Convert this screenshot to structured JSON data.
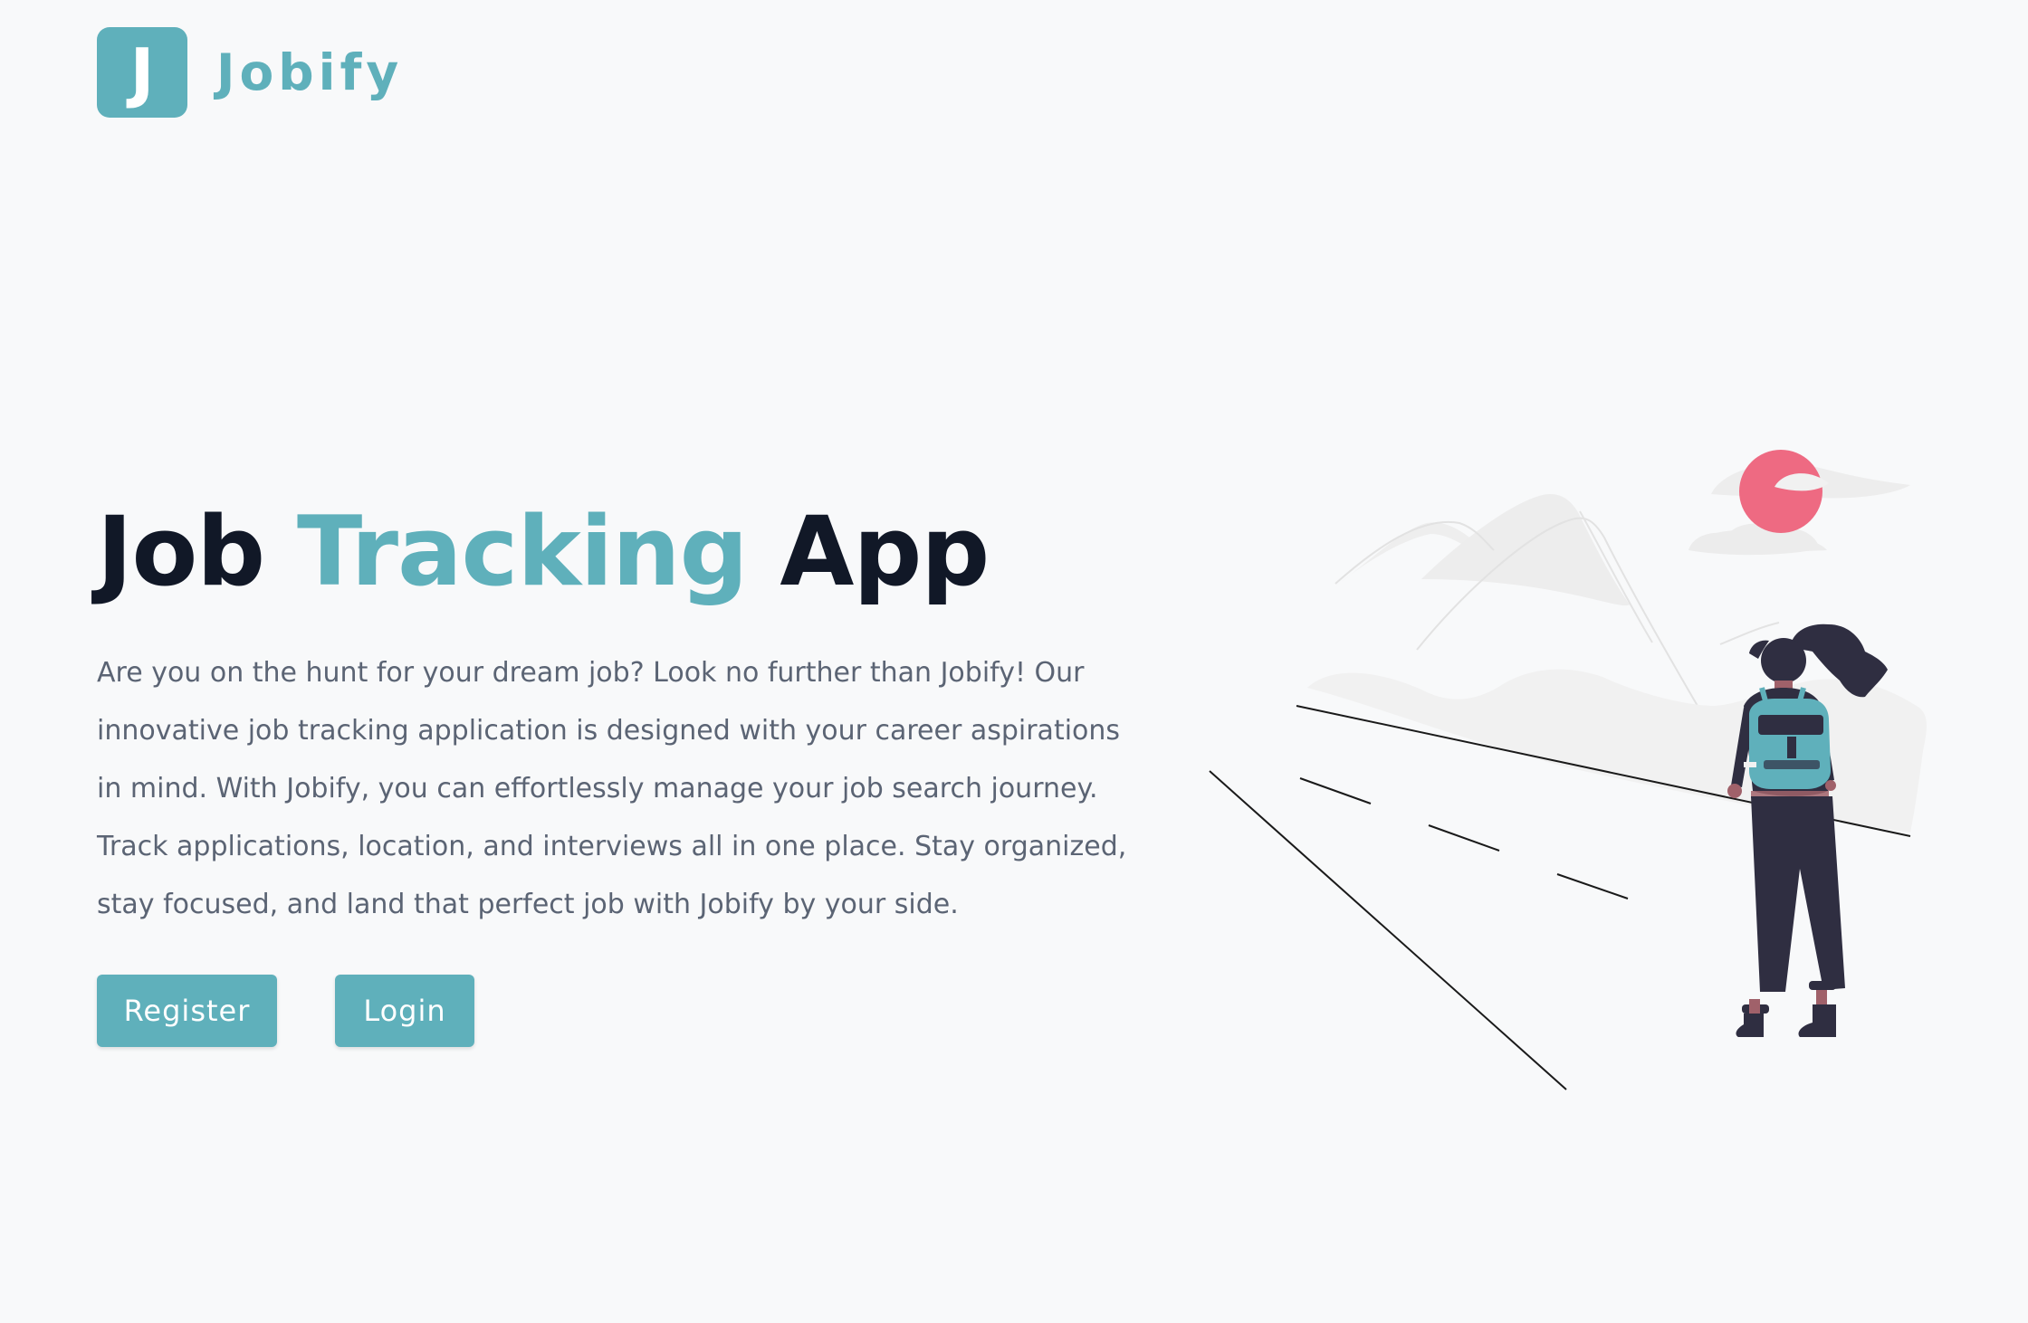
{
  "brand": {
    "logo_letter": "J",
    "name": "Jobify",
    "accent_color": "#5fb0bb"
  },
  "hero": {
    "title_part1": "Job",
    "title_accent": "Tracking",
    "title_part2": "App",
    "description": "Are you on the hunt for your dream job? Look no further than Jobify! Our innovative job tracking application is designed with your career aspirations in mind. With Jobify, you can effortlessly manage your job search journey. Track applications, location, and interviews all in one place. Stay organized, stay focused, and land that perfect job with Jobify by your side."
  },
  "buttons": {
    "register_label": "Register",
    "login_label": "Login"
  },
  "illustration": {
    "icon": "woman-with-backpack-looking-at-mountains-illustration",
    "sun_color": "#ee6a82",
    "figure_color": "#2f2e41",
    "backpack_color": "#5fb0bb"
  }
}
